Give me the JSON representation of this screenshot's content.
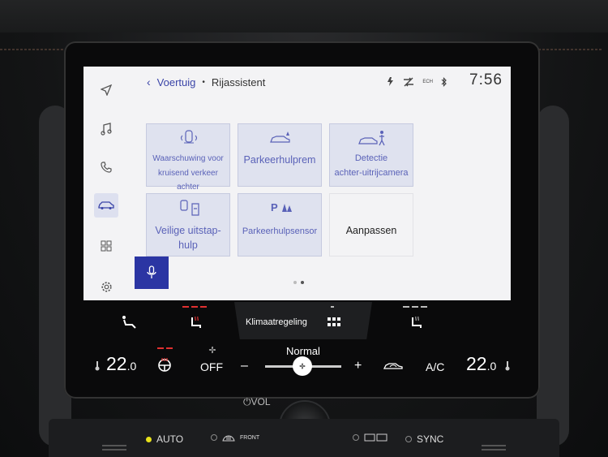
{
  "header": {
    "back_glyph": "‹",
    "crumb_parent": "Voertuig",
    "crumb_sep": "•",
    "crumb_current": "Rijassistent",
    "clock": "7:56",
    "status_icons": [
      "wireless-charge-icon",
      "connectivity-off-icon",
      "ech-icon",
      "bluetooth-icon"
    ],
    "ech_text": "ECH"
  },
  "sidebar": {
    "items": [
      {
        "name": "navigation",
        "icon": "navigation-arrow-icon"
      },
      {
        "name": "music",
        "icon": "music-note-icon"
      },
      {
        "name": "phone",
        "icon": "phone-icon"
      },
      {
        "name": "vehicle",
        "icon": "car-icon",
        "active": true
      },
      {
        "name": "apps",
        "icon": "grid-icon"
      },
      {
        "name": "settings",
        "icon": "gear-icon"
      }
    ],
    "voice_icon": "microphone-icon"
  },
  "tiles": [
    {
      "id": "rcta",
      "lines": [
        "Waarschuwing voor",
        "kruisend verkeer achter"
      ],
      "icon": "rear-cross-traffic-icon"
    },
    {
      "id": "park-brake",
      "lines": [
        "Parkeerhulprem"
      ],
      "icon": "parking-brake-car-icon"
    },
    {
      "id": "rear-camera",
      "lines": [
        "Detectie",
        "achter-uitrijcamera"
      ],
      "icon": "pedestrian-detect-icon"
    },
    {
      "id": "safe-exit",
      "lines": [
        "Veilige uitstap-",
        "hulp"
      ],
      "icon": "safe-exit-icon"
    },
    {
      "id": "park-sensor",
      "lines": [
        "Parkeerhulpsensor"
      ],
      "icon": "parking-sensor-icon"
    },
    {
      "id": "customize",
      "lines": [
        "Aanpassen"
      ],
      "icon": ""
    }
  ],
  "pager": {
    "pages": 2,
    "current": 2
  },
  "climate": {
    "tab_label": "Klimaatregeling",
    "left_temp": "22",
    "left_temp_decimal": ".0",
    "right_temp": "22",
    "right_temp_decimal": ".0",
    "fan_mode": "Normal",
    "off_label": "OFF",
    "minus": "–",
    "plus": "+",
    "ac_label": "A/C",
    "accent_red": "#e03030",
    "accent_grey": "#bbbbbb"
  },
  "hardware": {
    "vol_label": "VOL",
    "auto_label": "AUTO",
    "front_label": "FRONT",
    "sync_label": "SYNC",
    "led_color": "#e8e21a"
  }
}
